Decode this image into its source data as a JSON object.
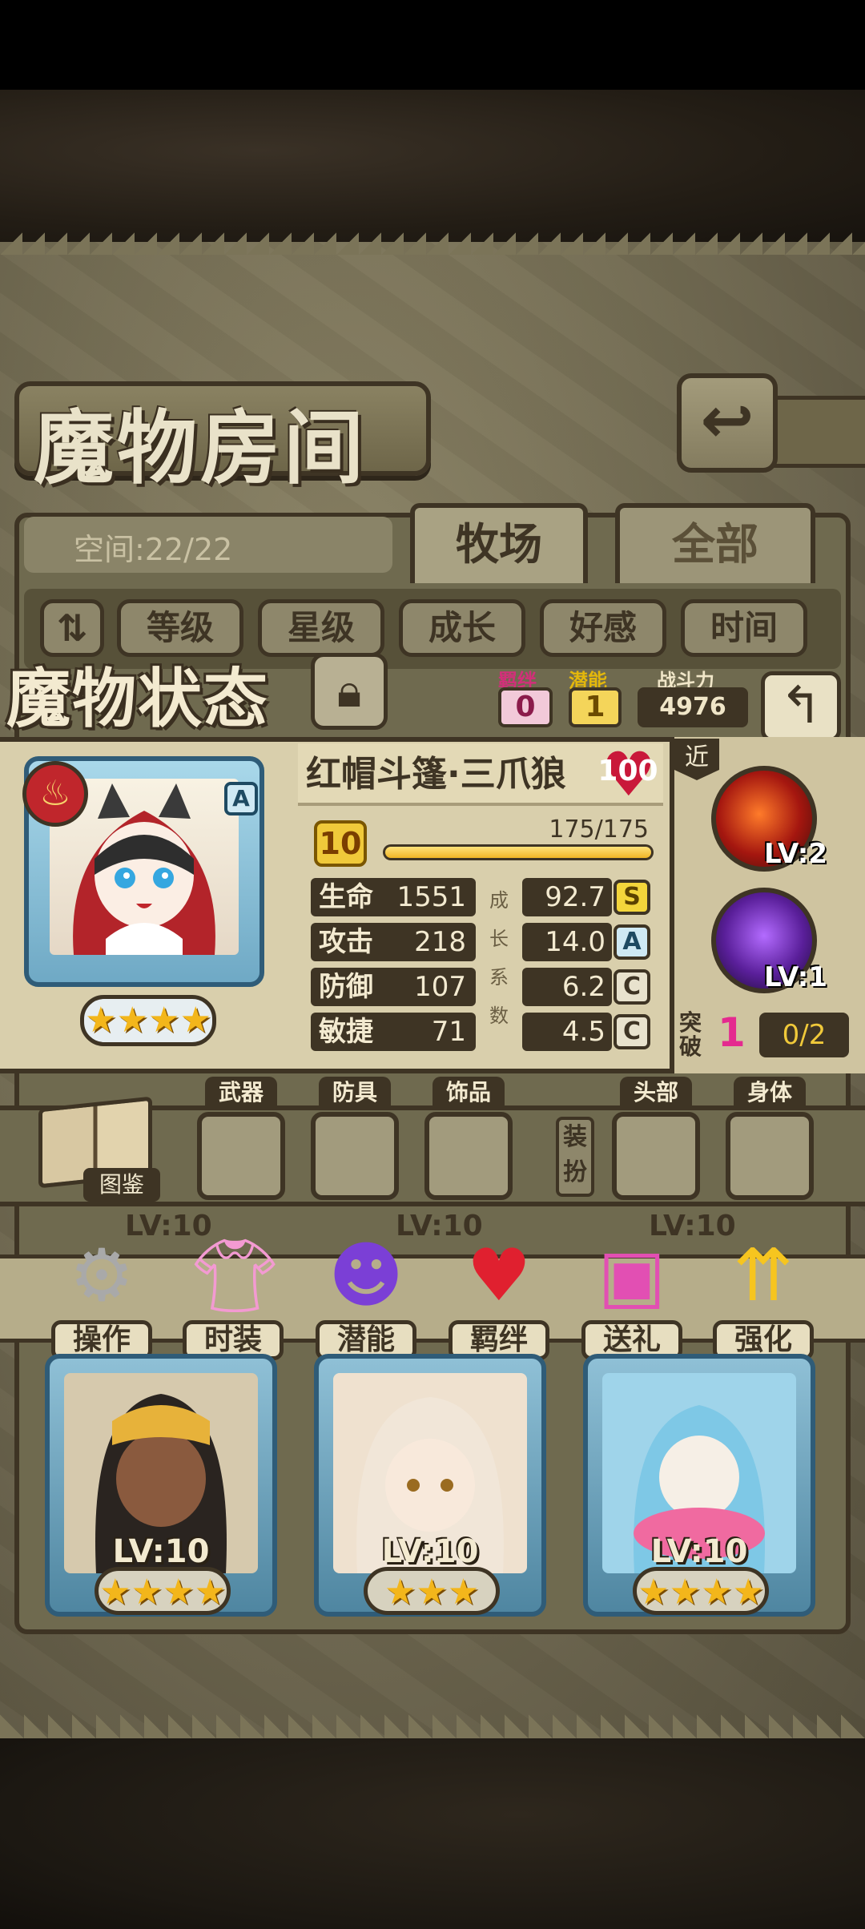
{
  "header": {
    "title": "魔物房间",
    "back_icon": "return-icon"
  },
  "room": {
    "space_text": "空间:22/22",
    "tabs": [
      {
        "label": "牧场",
        "active": true
      },
      {
        "label": "全部",
        "active": false
      }
    ],
    "sort_buttons": [
      "等级",
      "星级",
      "成长",
      "好感",
      "时间"
    ]
  },
  "status": {
    "title": "魔物状态",
    "bond_label": "羁绊",
    "bond_value": "0",
    "potential_label": "潜能",
    "potential_value": "1",
    "power_label": "战斗力",
    "power_value": "4976"
  },
  "monster": {
    "name": "红帽斗篷·三爪狼",
    "affection": "100",
    "level": "10",
    "xp_text": "175/175",
    "xp_fraction": 1.0,
    "rank": "A",
    "stars": 4,
    "element_icon": "fire-icon",
    "stats": [
      {
        "label": "生命",
        "value": "1551",
        "growth": "92.7",
        "grade": "S"
      },
      {
        "label": "攻击",
        "value": "218",
        "growth": "14.0",
        "grade": "A"
      },
      {
        "label": "防御",
        "value": "107",
        "growth": "6.2",
        "grade": "C"
      },
      {
        "label": "敏捷",
        "value": "71",
        "growth": "4.5",
        "grade": "C"
      }
    ],
    "growth_vertical": [
      "成",
      "长",
      "系",
      "数"
    ]
  },
  "skills": {
    "range_tag": "近",
    "items": [
      {
        "name": "claw-skill-icon",
        "level": "LV:2"
      },
      {
        "name": "shadow-skill-icon",
        "level": "LV:1"
      }
    ],
    "break_label": "突破",
    "break_value": "1",
    "break_progress": "0/2"
  },
  "equipment": {
    "book_label": "图鉴",
    "slots": [
      "武器",
      "防具",
      "饰品",
      "头部",
      "身体"
    ],
    "dress_label": "装扮"
  },
  "actions": [
    {
      "label": "操作",
      "icon": "gear-icon"
    },
    {
      "label": "时装",
      "icon": "outfit-icon"
    },
    {
      "label": "潜能",
      "icon": "potential-demon-icon"
    },
    {
      "label": "羁绊",
      "icon": "bond-hearts-icon"
    },
    {
      "label": "送礼",
      "icon": "gift-icon"
    },
    {
      "label": "强化",
      "icon": "upgrade-arrows-icon"
    }
  ],
  "cards": [
    {
      "level": "LV:10",
      "stars": 4
    },
    {
      "level": "LV:10",
      "stars": 3
    },
    {
      "level": "LV:10",
      "stars": 4
    }
  ],
  "card_levels_top": [
    "LV:10",
    "LV:10",
    "LV:10"
  ],
  "colors": {
    "frame_dark": "#3e3424",
    "parchment": "#d9cfac",
    "bond_pink": "#e42a8f",
    "gold": "#f0c93a",
    "card_blue": "#2f5c78"
  }
}
